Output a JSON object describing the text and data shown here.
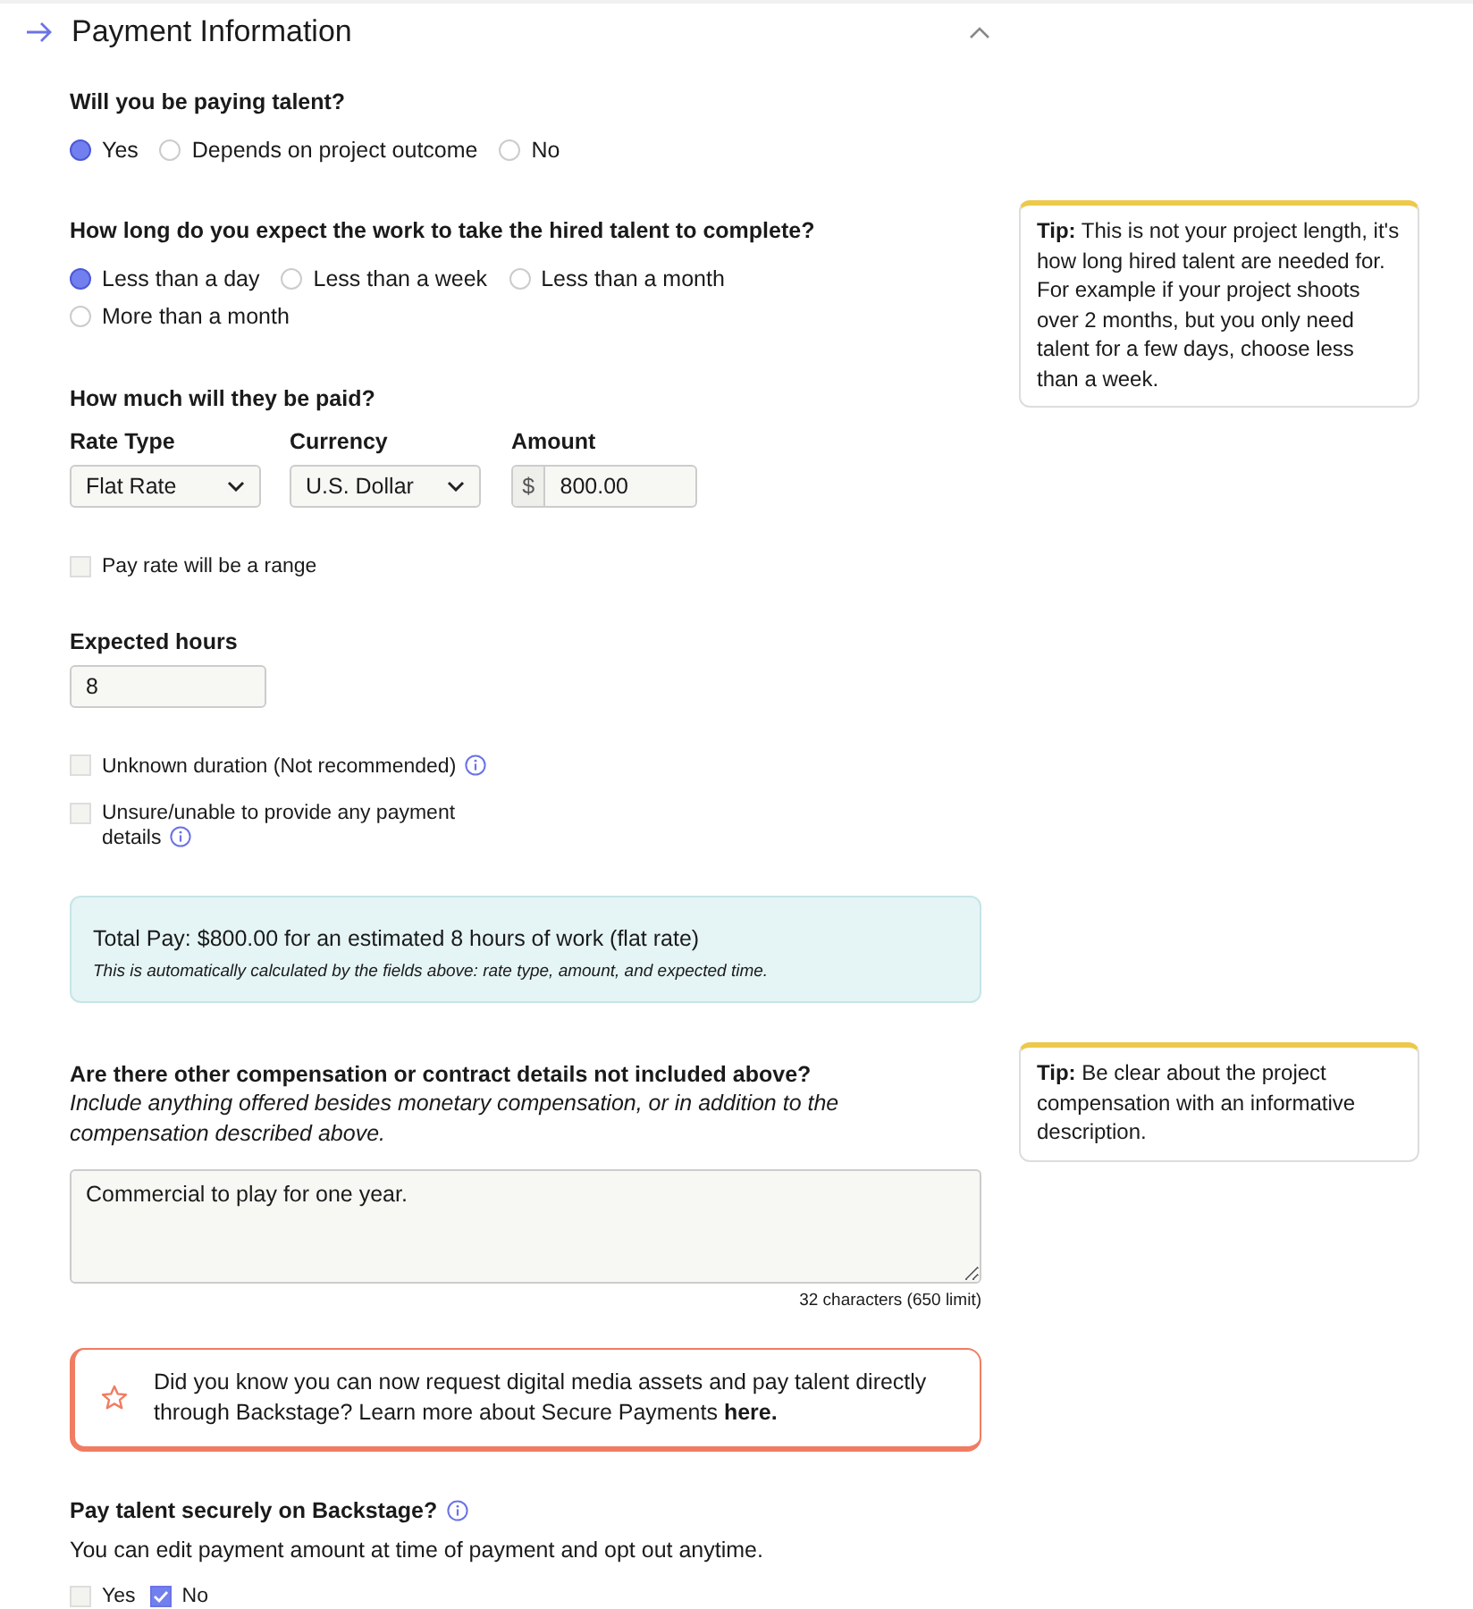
{
  "section": {
    "title": "Payment Information",
    "expanded": true
  },
  "paying": {
    "question": "Will you be paying talent?",
    "options": [
      {
        "label": "Yes",
        "selected": true
      },
      {
        "label": "Depends on project outcome",
        "selected": false
      },
      {
        "label": "No",
        "selected": false
      }
    ]
  },
  "duration": {
    "question": "How long do you expect the work to take the hired talent to complete?",
    "options": [
      {
        "label": "Less than a day",
        "selected": true
      },
      {
        "label": "Less than a week",
        "selected": false
      },
      {
        "label": "Less than a month",
        "selected": false
      },
      {
        "label": "More than a month",
        "selected": false
      }
    ],
    "tip": "**Tip:** This is not your project length, it's how long hired talent are needed for. For example if your project shoots over 2 months, but you only need talent for a few days, choose less than a week."
  },
  "pay": {
    "question": "How much will they be paid?",
    "rate_type": {
      "label": "Rate Type",
      "value": "Flat Rate"
    },
    "currency": {
      "label": "Currency",
      "value": "U.S. Dollar"
    },
    "amount": {
      "label": "Amount",
      "prefix": "$",
      "value": "800.00"
    },
    "range": {
      "label": "Pay rate will be a range",
      "checked": false
    }
  },
  "hours": {
    "label": "Expected hours",
    "value": "8"
  },
  "checks": [
    {
      "label": "Unknown duration (Not recommended)",
      "checked": false,
      "info": true
    },
    {
      "label": "Unsure/unable to provide any payment details",
      "checked": false,
      "info": true
    }
  ],
  "total": {
    "text": "Total Pay: $800.00 for an estimated 8 hours of work (flat rate)",
    "note": "This is automatically calculated by the fields above: rate type, amount, and expected time."
  },
  "other": {
    "question": "Are there other compensation or contract details not included above?",
    "hint": "Include anything offered besides monetary compensation, or in addition to the compensation described above.",
    "value": "Commercial to play for one year.",
    "counter": "32 characters (650 limit)",
    "tip": "**Tip:** Be clear about the project compensation with an informative description."
  },
  "callout": {
    "text": "Did you know you can now request digital media assets and pay talent directly through Backstage? Learn more about Secure Payments **here.**"
  },
  "secure": {
    "question": "Pay talent securely on Backstage?",
    "note": "You can edit payment amount at time of payment and opt out anytime.",
    "options": [
      {
        "label": "Yes",
        "checked": false
      },
      {
        "label": "No",
        "checked": true
      }
    ]
  }
}
